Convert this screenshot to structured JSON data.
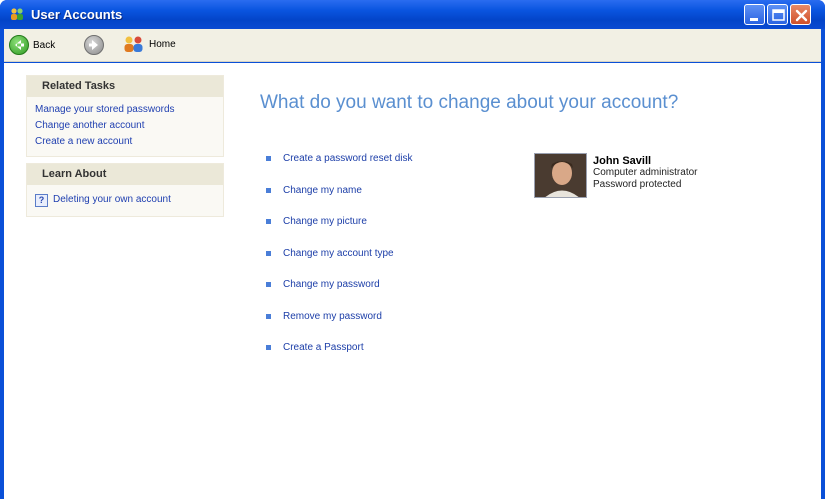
{
  "window": {
    "title": "User Accounts",
    "controls": [
      "minimize-icon",
      "maximize-icon",
      "close-icon"
    ]
  },
  "toolbar": {
    "back_label": "Back",
    "home_label": "Home"
  },
  "sidebar": {
    "related_tasks": {
      "heading": "Related Tasks",
      "items": [
        "Manage your stored passwords",
        "Change another account",
        "Create a new account"
      ]
    },
    "learn_about": {
      "heading": "Learn About",
      "items": [
        "Deleting your own account"
      ]
    }
  },
  "main": {
    "heading": "What do you want to change about your account?",
    "options": [
      "Create a password reset disk",
      "Change my name",
      "Change my picture",
      "Change my account type",
      "Change my password",
      "Remove my password",
      "Create a Passport"
    ]
  },
  "user": {
    "name": "John Savill",
    "role": "Computer administrator",
    "status": "Password protected"
  },
  "colors": {
    "titlebar": "#0a55e0",
    "heading": "#5a8fd0",
    "link": "#1f3fb0"
  }
}
